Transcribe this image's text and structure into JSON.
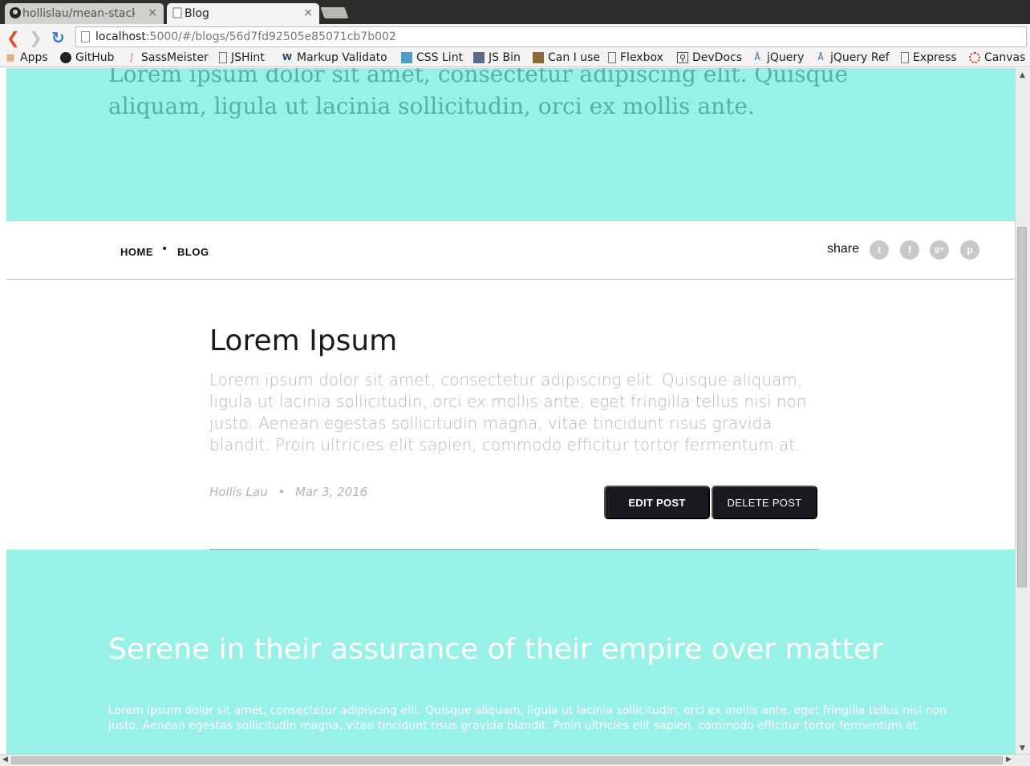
{
  "browser": {
    "tabs": [
      {
        "label": "hollislau/mean-stack",
        "close": "×"
      },
      {
        "label": "Blog",
        "close": "×"
      }
    ],
    "url_host": "localhost",
    "url_rest": ":5000/#/blogs/56d7fd92505e85071cb7b002",
    "bookmarks": [
      "Apps",
      "GitHub",
      "SassMeister",
      "JSHint",
      "Markup Validato",
      "CSS Lint",
      "JS Bin",
      "Can I use",
      "Flexbox",
      "DevDocs",
      "jQuery",
      "jQuery Ref",
      "Express",
      "Canvas"
    ]
  },
  "hero": {
    "text": "Lorem ipsum dolor sit amet, consectetur adipiscing elit. Quisque aliquam, ligula ut lacinia sollicitudin, orci ex mollis ante."
  },
  "nav": {
    "home": "HOME",
    "blog": "BLOG",
    "separator": "•",
    "share": "share",
    "social_icons": [
      "twitter-icon",
      "facebook-icon",
      "google-plus-icon",
      "pinterest-icon"
    ]
  },
  "post": {
    "title": "Lorem Ipsum",
    "body": "Lorem ipsum dolor sit amet, consectetur adipiscing elit. Quisque aliquam, ligula ut lacinia sollicitudin, orci ex mollis ante, eget fringilla tellus nisi non justo. Aenean egestas sollicitudin magna, vitae tincidunt risus gravida blandit. Proin ultricies elit sapien, commodo efficitur tortor fermentum at.",
    "author": "Hollis Lau",
    "meta_sep": "•",
    "date": "Mar 3, 2016",
    "edit_label": "EDIT POST",
    "delete_label": "DELETE POST"
  },
  "footer": {
    "title": "Serene in their assurance of their empire over matter",
    "body": "Lorem ipsum dolor sit amet, consectetur adipiscing elit. Quisque aliquam, ligula ut lacinia sollicitudin, orci ex mollis ante, eget fringilla tellus nisi non justo. Aenean egestas sollicitudin magna, vitae tincidunt risus gravida blandit. Proin ultricies elit sapien, commodo efficitur tortor fermentum at."
  },
  "colors": {
    "accent": "#98f1e6",
    "button": "#1a1a20"
  }
}
